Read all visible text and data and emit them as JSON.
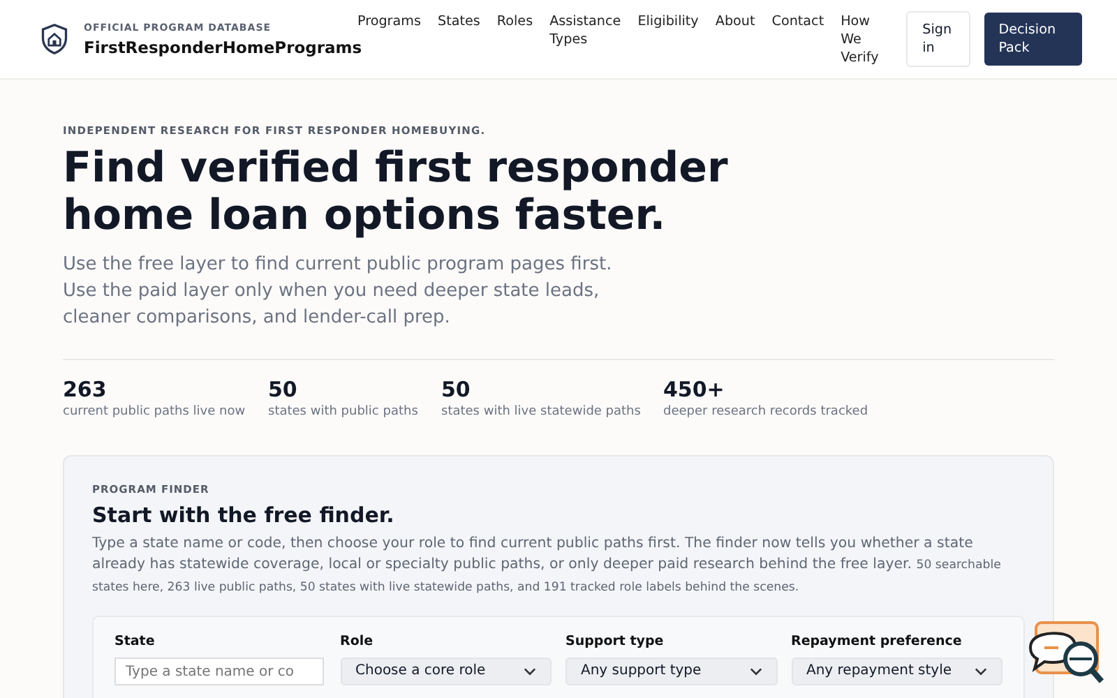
{
  "brand": {
    "tagline": "OFFICIAL PROGRAM DATABASE",
    "name": "FirstResponderHomePrograms"
  },
  "nav": [
    "Programs",
    "States",
    "Roles",
    "Assistance Types",
    "Eligibility",
    "About",
    "Contact",
    "How We Verify"
  ],
  "sign_in": "Sign in",
  "cta": "Decision Pack",
  "hero": {
    "eyebrow": "INDEPENDENT RESEARCH FOR FIRST RESPONDER HOMEBUYING.",
    "title": "Find verified first responder home loan options faster.",
    "lead": "Use the free layer to find current public program pages first. Use the paid layer only when you need deeper state leads, cleaner comparisons, and lender-call prep."
  },
  "stats": [
    {
      "value": "263",
      "label": "current public paths live now"
    },
    {
      "value": "50",
      "label": "states with public paths"
    },
    {
      "value": "50",
      "label": "states with live statewide paths"
    },
    {
      "value": "450+",
      "label": "deeper research records tracked"
    }
  ],
  "finder": {
    "eyebrow": "PROGRAM FINDER",
    "title": "Start with the free finder.",
    "intro": "Type a state name or code, then choose your role to find current public paths first. The finder now tells you whether a state already has statewide coverage, local or specialty public paths, or only deeper paid research behind the free layer.",
    "note": "50 searchable states here, 263 live public paths, 50 states with live statewide paths, and 191 tracked role labels behind the scenes.",
    "fields": [
      {
        "kind": "text",
        "label": "State",
        "placeholder": "Type a state name or co"
      },
      {
        "kind": "select",
        "label": "Role",
        "value": "Choose a core role"
      },
      {
        "kind": "select",
        "label": "Support type",
        "value": "Any support type"
      },
      {
        "kind": "select",
        "label": "Repayment preference",
        "value": "Any repayment style"
      }
    ]
  }
}
